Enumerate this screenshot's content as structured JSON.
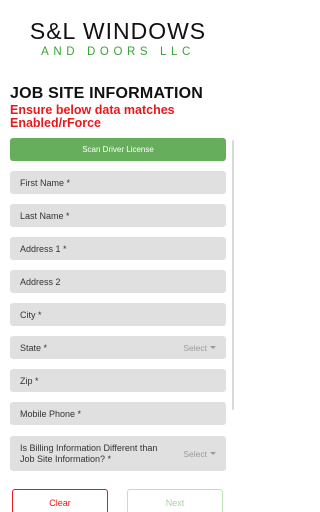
{
  "logo": {
    "line1": "S&L WINDOWS",
    "line2": "AND DOORS LLC"
  },
  "header": {
    "title": "JOB SITE INFORMATION",
    "warning": "Ensure below data matches Enabled/rForce"
  },
  "scan_button": {
    "label": "Scan Driver License"
  },
  "fields": {
    "first_name": "First Name *",
    "last_name": "Last Name *",
    "address1": "Address 1 *",
    "address2": "Address 2",
    "city": "City *",
    "state": "State *",
    "zip": "Zip *",
    "mobile_phone": "Mobile Phone *",
    "billing_different": "Is Billing Information Different than Job Site Information? *"
  },
  "selects": {
    "state_value": "Select",
    "billing_value": "Select"
  },
  "footer": {
    "clear_label": "Clear",
    "next_label": "Next"
  },
  "colors": {
    "brand_green": "#3aa435",
    "scan_button": "#66ad5c",
    "warning_red": "#e8191c",
    "field_bg": "#e0e0e0"
  }
}
